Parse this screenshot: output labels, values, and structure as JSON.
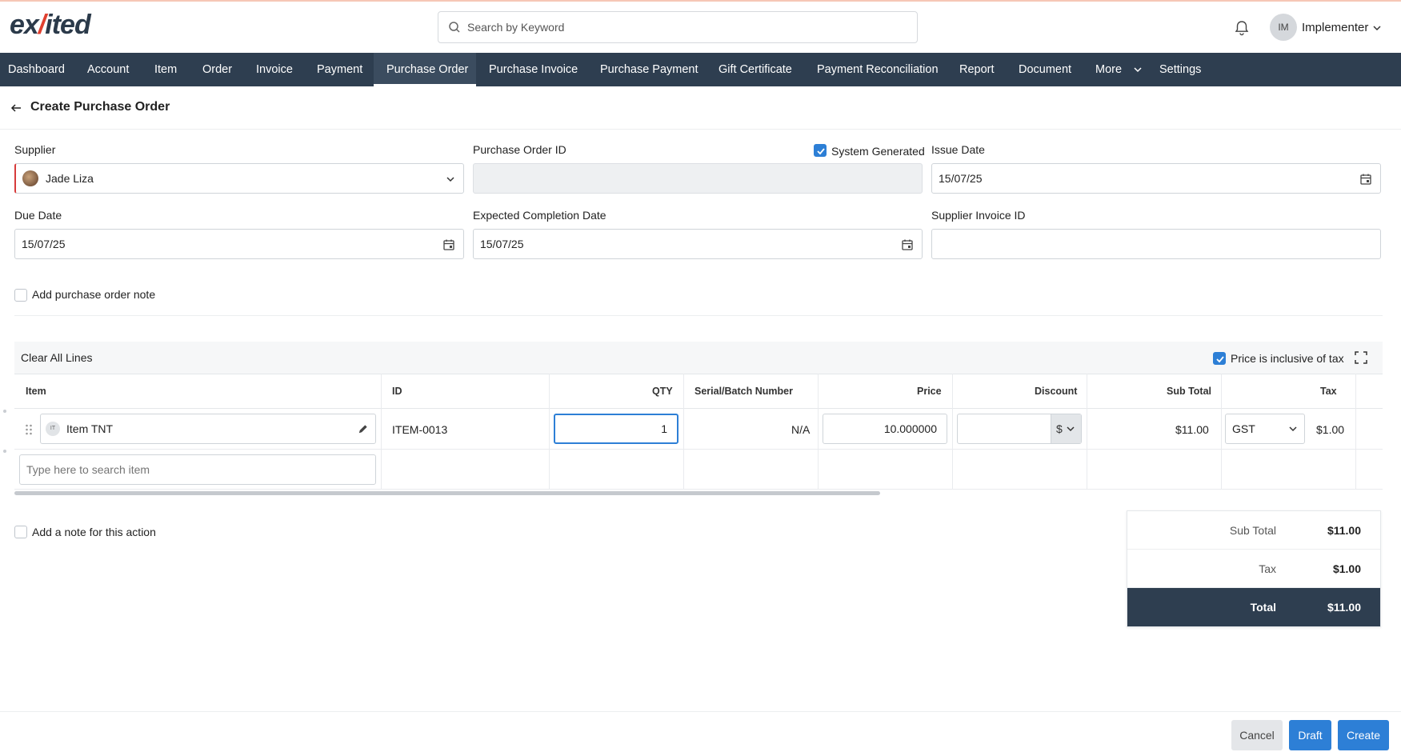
{
  "app": {
    "logo_text_a": "ex",
    "logo_slash": "/",
    "logo_text_b": "ited"
  },
  "header": {
    "search_placeholder": "Search by Keyword",
    "user_initials": "IM",
    "user_name": "Implementer"
  },
  "nav": {
    "items": [
      "Dashboard",
      "Account",
      "Item",
      "Order",
      "Invoice",
      "Payment",
      "Purchase Order",
      "Purchase Invoice",
      "Purchase Payment",
      "Gift Certificate",
      "Payment Reconciliation",
      "Report",
      "Document",
      "More",
      "Settings"
    ],
    "active": "Purchase Order"
  },
  "page": {
    "title": "Create Purchase Order"
  },
  "form": {
    "supplier_label": "Supplier",
    "supplier_value": "Jade Liza",
    "po_id_label": "Purchase Order ID",
    "po_id_value": "",
    "system_generated_label": "System Generated",
    "system_generated_checked": true,
    "issue_date_label": "Issue Date",
    "issue_date_value": "15/07/25",
    "due_date_label": "Due Date",
    "due_date_value": "15/07/25",
    "expected_completion_label": "Expected Completion Date",
    "expected_completion_value": "15/07/25",
    "supplier_invoice_label": "Supplier Invoice ID",
    "supplier_invoice_value": "",
    "add_note_label": "Add purchase order note"
  },
  "lines": {
    "clear_label": "Clear All Lines",
    "price_inclusive_label": "Price is inclusive of tax",
    "price_inclusive_checked": true,
    "columns": [
      "Item",
      "ID",
      "QTY",
      "Serial/Batch Number",
      "Price",
      "Discount",
      "Sub Total",
      "Tax"
    ],
    "rows": [
      {
        "item_badge": "IT",
        "item": "Item TNT",
        "id": "ITEM-0013",
        "qty": "1",
        "serial": "N/A",
        "price": "10.000000",
        "discount": "",
        "discount_unit": "$",
        "subtotal": "$11.00",
        "tax_code": "GST",
        "tax": "$1.00"
      }
    ],
    "search_placeholder": "Type here to search item"
  },
  "action_note_label": "Add a note for this action",
  "totals": {
    "subtotal_label": "Sub Total",
    "subtotal_value": "$11.00",
    "tax_label": "Tax",
    "tax_value": "$1.00",
    "total_label": "Total",
    "total_value": "$11.00"
  },
  "footer": {
    "cancel": "Cancel",
    "draft": "Draft",
    "create": "Create"
  },
  "colors": {
    "nav_bg": "#2e3e50",
    "primary": "#2d7fd6",
    "logo_accent": "#e0402f"
  }
}
